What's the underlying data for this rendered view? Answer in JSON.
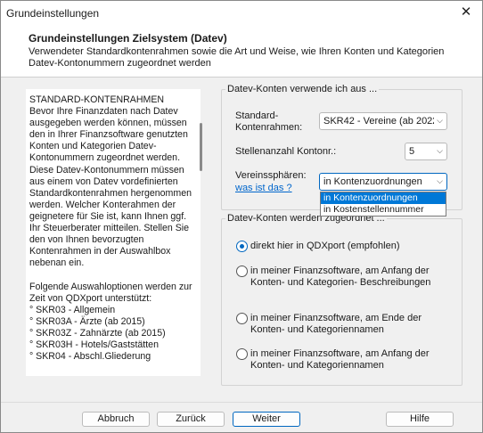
{
  "window": {
    "title": "Grundeinstellungen"
  },
  "header": {
    "title": "Grundeinstellungen Zielsystem (Datev)",
    "description": "Verwendeter Standardkontenrahmen sowie die Art und Weise, wie Ihren Konten und Kategorien Datev-Kontonummern zugeordnet werden"
  },
  "info": {
    "text": "STANDARD-KONTENRAHMEN\nBevor Ihre Finanzdaten nach Datev ausgegeben werden können, müssen den in Ihrer Finanzsoftware genutzten Konten und Kategorien Datev-Kontonummern zugeordnet werden. Diese Datev-Kontonummern müssen aus einem von Datev vordefinierten Standardkontenrahmen hergenommen werden. Welcher Konterahmen der geignetere für Sie ist, kann Ihnen ggf. Ihr Steuerberater mitteilen. Stellen Sie den von Ihnen bevorzugten Kontenrahmen in der Auswahlbox nebenan ein.\n\nFolgende Auswahloptionen werden zur Zeit von QDXport unterstützt:\n° SKR03 - Allgemein\n° SKR03A - Ärzte (ab 2015)\n° SKR03Z - Zahnärzte (ab 2015)\n° SKR03H - Hotels/Gaststätten\n° SKR04 - Abschl.Gliederung"
  },
  "group_konten": {
    "legend": "Datev-Konten verwende ich aus ...",
    "standard_label": "Standard-\nKontenrahmen:",
    "standard_value": "SKR42 - Vereine (ab 2022",
    "stellen_label": "Stellenanzahl Kontonr.:",
    "stellen_value": "5",
    "spheres_label": "Vereinssphären:",
    "spheres_value": "in Kontenzuordnungen",
    "spheres_link": "was ist das ?",
    "spheres_options": [
      "in Kontenzuordnungen",
      "in Kostenstellennummer"
    ]
  },
  "group_zuordnung": {
    "legend": "Datev-Konten werden zugeordnet ...",
    "options": [
      {
        "label": "direkt hier in QDXport (empfohlen)",
        "checked": true
      },
      {
        "label": "in meiner Finanzsoftware, am Anfang der Konten- und Kategorien- Beschreibungen",
        "checked": false
      },
      {
        "label": "in meiner Finanzsoftware, am Ende der Konten- und Kategoriennamen",
        "checked": false
      },
      {
        "label": "in meiner Finanzsoftware, am Anfang der Konten- und Kategoriennamen",
        "checked": false
      }
    ]
  },
  "footer": {
    "cancel": "Abbruch",
    "back": "Zurück",
    "next": "Weiter",
    "help": "Hilfe"
  },
  "colors": {
    "accent": "#0067c0",
    "selection": "#0078d7",
    "link": "#0066cc"
  }
}
